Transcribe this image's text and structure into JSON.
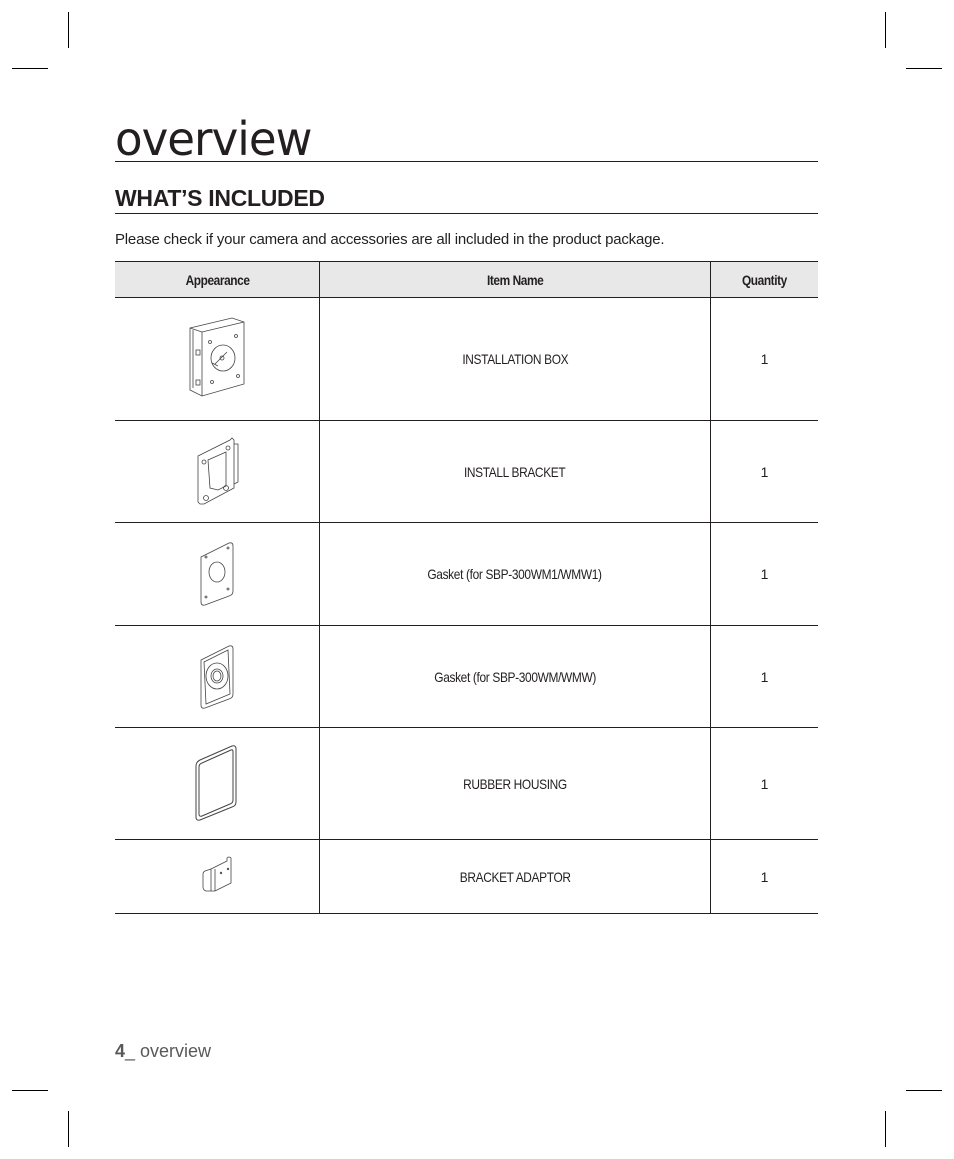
{
  "page": {
    "chapter_title": "overview",
    "section_title": "WHAT’S INCLUDED",
    "intro_text": "Please check if your camera and accessories are all included in the product package."
  },
  "table": {
    "headers": {
      "appearance": "Appearance",
      "item_name": "Item Name",
      "quantity": "Quantity"
    },
    "rows": [
      {
        "icon": "installation-box-icon",
        "name": "INSTALLATION BOX",
        "quantity": "1"
      },
      {
        "icon": "install-bracket-icon",
        "name": "INSTALL BRACKET",
        "quantity": "1"
      },
      {
        "icon": "gasket-wm1-icon",
        "name": "Gasket (for SBP-300WM1/WMW1)",
        "quantity": "1"
      },
      {
        "icon": "gasket-wm-icon",
        "name": "Gasket (for SBP-300WM/WMW)",
        "quantity": "1"
      },
      {
        "icon": "rubber-housing-icon",
        "name": "RUBBER HOUSING",
        "quantity": "1"
      },
      {
        "icon": "bracket-adaptor-icon",
        "name": "BRACKET ADAPTOR",
        "quantity": "1"
      }
    ]
  },
  "footer": {
    "page_number": "4",
    "separator": "_ ",
    "section": "overview"
  }
}
